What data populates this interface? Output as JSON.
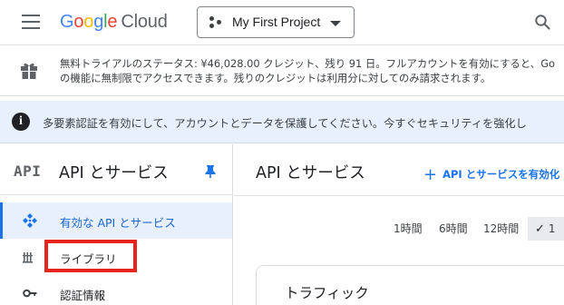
{
  "header": {
    "logo_google": [
      "G",
      "o",
      "o",
      "g",
      "l",
      "e"
    ],
    "logo_product": "Cloud",
    "project_name": "My First Project"
  },
  "trial_banner": {
    "line1": "無料トライアルのステータス: ¥46,028.00 クレジット、残り 91 日。フルアカウントを有効にすると、Go",
    "line2": "の機能に無制限でアクセスできます。残りのクレジットは利用分に対してのみ請求されます。"
  },
  "mfa_banner": {
    "text": "多要素認証を有効にして、アカウントとデータを保護してください。今すぐセキュリティを強化し"
  },
  "sidenav": {
    "glyph": "API",
    "title": "API とサービス",
    "items": [
      {
        "label": "有効な API とサービス",
        "icon": "enabled-apis-icon",
        "active": true
      },
      {
        "label": "ライブラリ",
        "icon": "library-icon",
        "active": false
      },
      {
        "label": "認証情報",
        "icon": "key-icon",
        "active": false
      }
    ]
  },
  "main": {
    "title": "API とサービス",
    "enable_button": "API とサービスを有効化",
    "ranges": [
      "1時間",
      "6時間",
      "12時間",
      "1"
    ],
    "selected_range_index": 3,
    "card_title": "トラフィック"
  },
  "colors": {
    "accent": "#1a73e8",
    "highlight": "#e8251c",
    "mfa_background": "#e8f0fe"
  }
}
